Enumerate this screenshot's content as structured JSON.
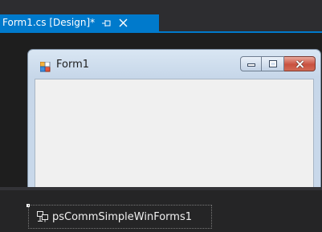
{
  "document_tab": {
    "title": "Form1.cs [Design]*",
    "pin_glyph": "⊸",
    "close_glyph": "✕"
  },
  "form": {
    "title": "Form1",
    "icon": "form-icon",
    "caption_buttons": [
      "minimize-icon",
      "maximize-icon",
      "close-icon"
    ]
  },
  "component_tray": {
    "items": [
      {
        "label": "psCommSimpleWinForms1",
        "icon": "component-icon"
      }
    ]
  },
  "colors": {
    "accent": "#007acc",
    "background": "#1e1e1e",
    "close_button": "#c9513f",
    "form_client": "#f0f0f0"
  }
}
